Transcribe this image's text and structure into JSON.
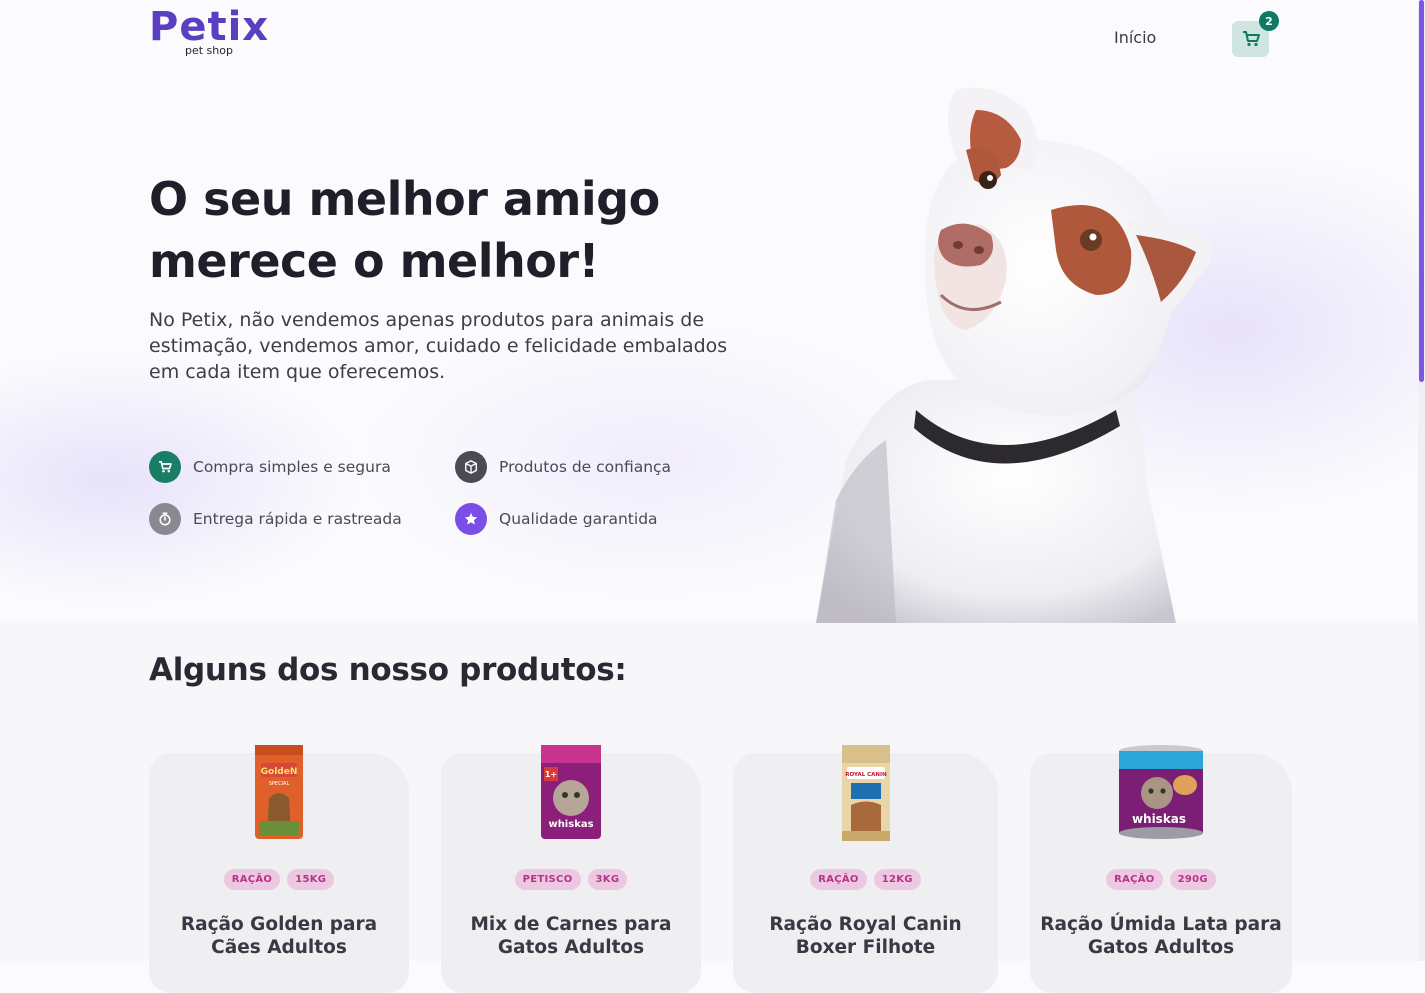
{
  "brand": {
    "name": "Petix",
    "tagline": "pet shop",
    "color": "#5a3fc0"
  },
  "nav": {
    "home_label": "Início",
    "cart_count": "2",
    "cart_icon": "cart-icon"
  },
  "hero": {
    "title": "O seu melhor amigo merece o melhor!",
    "description": "No Petix, não vendemos apenas produtos para animais de estimação, vendemos amor, cuidado e felicidade embalados em cada item que oferecemos.",
    "features": [
      {
        "label": "Compra simples e segura",
        "icon": "cart-icon",
        "color": "#1a7d66"
      },
      {
        "label": "Produtos de confiança",
        "icon": "box-icon",
        "color": "#4c4a52"
      },
      {
        "label": "Entrega rápida e rastreada",
        "icon": "stopwatch-icon",
        "color": "#8a8890"
      },
      {
        "label": "Qualidade garantida",
        "icon": "star-icon",
        "color": "#7b4ee8"
      }
    ]
  },
  "products": {
    "title": "Alguns dos nosso produtos:",
    "items": [
      {
        "tags": [
          "RAÇÃO",
          "15KG"
        ],
        "name": "Ração Golden para Cães Adultos",
        "brand_text": "GoldeN",
        "sub_text": "SPECIAL"
      },
      {
        "tags": [
          "PETISCO",
          "3KG"
        ],
        "name": "Mix de Carnes para Gatos Adultos",
        "brand_text": "whiskas",
        "sub_text": "1+"
      },
      {
        "tags": [
          "RAÇÃO",
          "12KG"
        ],
        "name": "Ração Royal Canin Boxer Filhote",
        "brand_text": "ROYAL CANIN",
        "sub_text": ""
      },
      {
        "tags": [
          "RAÇÃO",
          "290G"
        ],
        "name": "Ração Úmida Lata para Gatos Adultos",
        "brand_text": "whiskas",
        "sub_text": ""
      }
    ]
  },
  "colors": {
    "accent": "#0f7a63",
    "tag_bg": "#ecc9e1",
    "tag_text": "#b8338c",
    "scroll": "#7b56e8"
  }
}
